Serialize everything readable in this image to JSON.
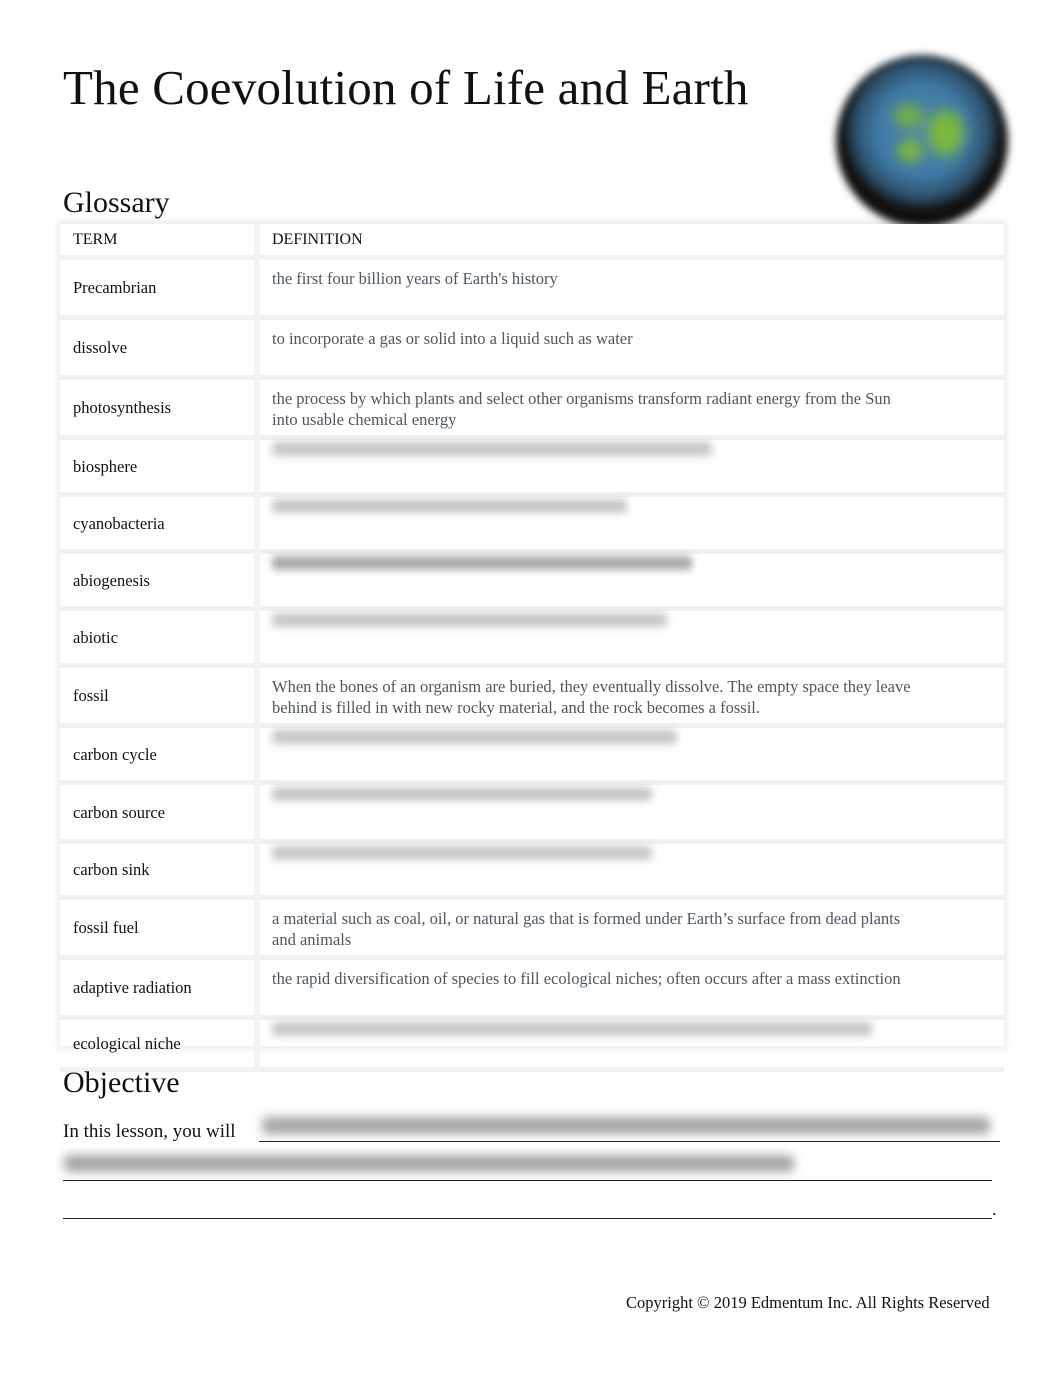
{
  "document": {
    "title": "The Coevolution of Life and Earth",
    "logo_icon": "earth-globe-icon"
  },
  "glossary": {
    "heading": "Glossary",
    "columns": [
      "TERM",
      "DEFINITION"
    ],
    "rows": [
      {
        "term": "Precambrian",
        "definition": "the first four billion years of Earth's history",
        "obscured": false
      },
      {
        "term": "dissolve",
        "definition": "to incorporate a gas or solid into a liquid such as water",
        "obscured": false
      },
      {
        "term": "photosynthesis",
        "definition": "the process by which plants and select other organisms transform radiant energy from the Sun into usable chemical energy",
        "obscured": false
      },
      {
        "term": "biosphere",
        "definition": "",
        "obscured": true
      },
      {
        "term": "cyanobacteria",
        "definition": "",
        "obscured": true
      },
      {
        "term": "abiogenesis",
        "definition": "",
        "obscured": true
      },
      {
        "term": "abiotic",
        "definition": "",
        "obscured": true
      },
      {
        "term": "fossil",
        "definition": "When the bones of an organism are buried, they eventually dissolve. The empty space they leave behind is filled in with new rocky material, and the rock becomes a fossil.",
        "obscured": false
      },
      {
        "term": "carbon cycle",
        "definition": "",
        "obscured": true
      },
      {
        "term": "carbon source",
        "definition": "",
        "obscured": true
      },
      {
        "term": "carbon sink",
        "definition": "",
        "obscured": true
      },
      {
        "term": "fossil fuel",
        "definition": "a material such as coal, oil, or natural gas that is formed under Earth’s surface from dead plants and animals",
        "obscured": false
      },
      {
        "term": "adaptive radiation",
        "definition": "the rapid diversification of species to fill ecological niches; often occurs after a mass extinction",
        "obscured": false
      },
      {
        "term": "ecological niche",
        "definition": "",
        "obscured": true
      }
    ]
  },
  "objective": {
    "heading": "Objective",
    "lead": "In this lesson, you will",
    "answer_obscured": true,
    "end_punctuation": "."
  },
  "footer": {
    "copyright": "Copyright © 2019 Edmentum Inc. All Rights Reserved"
  }
}
